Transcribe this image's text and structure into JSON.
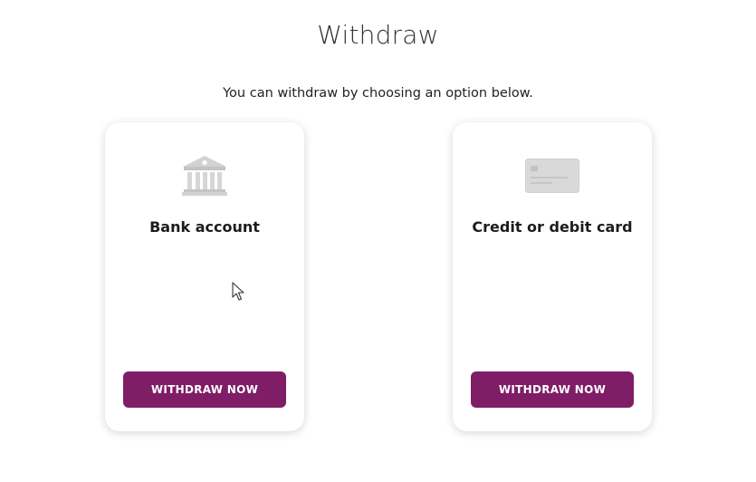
{
  "header": {
    "title": "Withdraw",
    "subtitle": "You can withdraw by choosing an option below."
  },
  "options": [
    {
      "label": "Bank account",
      "icon": "bank-icon",
      "button_label": "WITHDRAW NOW"
    },
    {
      "label": "Credit or debit card",
      "icon": "credit-card-icon",
      "button_label": "WITHDRAW NOW"
    }
  ],
  "colors": {
    "accent": "#7f1d66",
    "icon_gray": "#cfcfcf",
    "background": "#ffffff"
  }
}
